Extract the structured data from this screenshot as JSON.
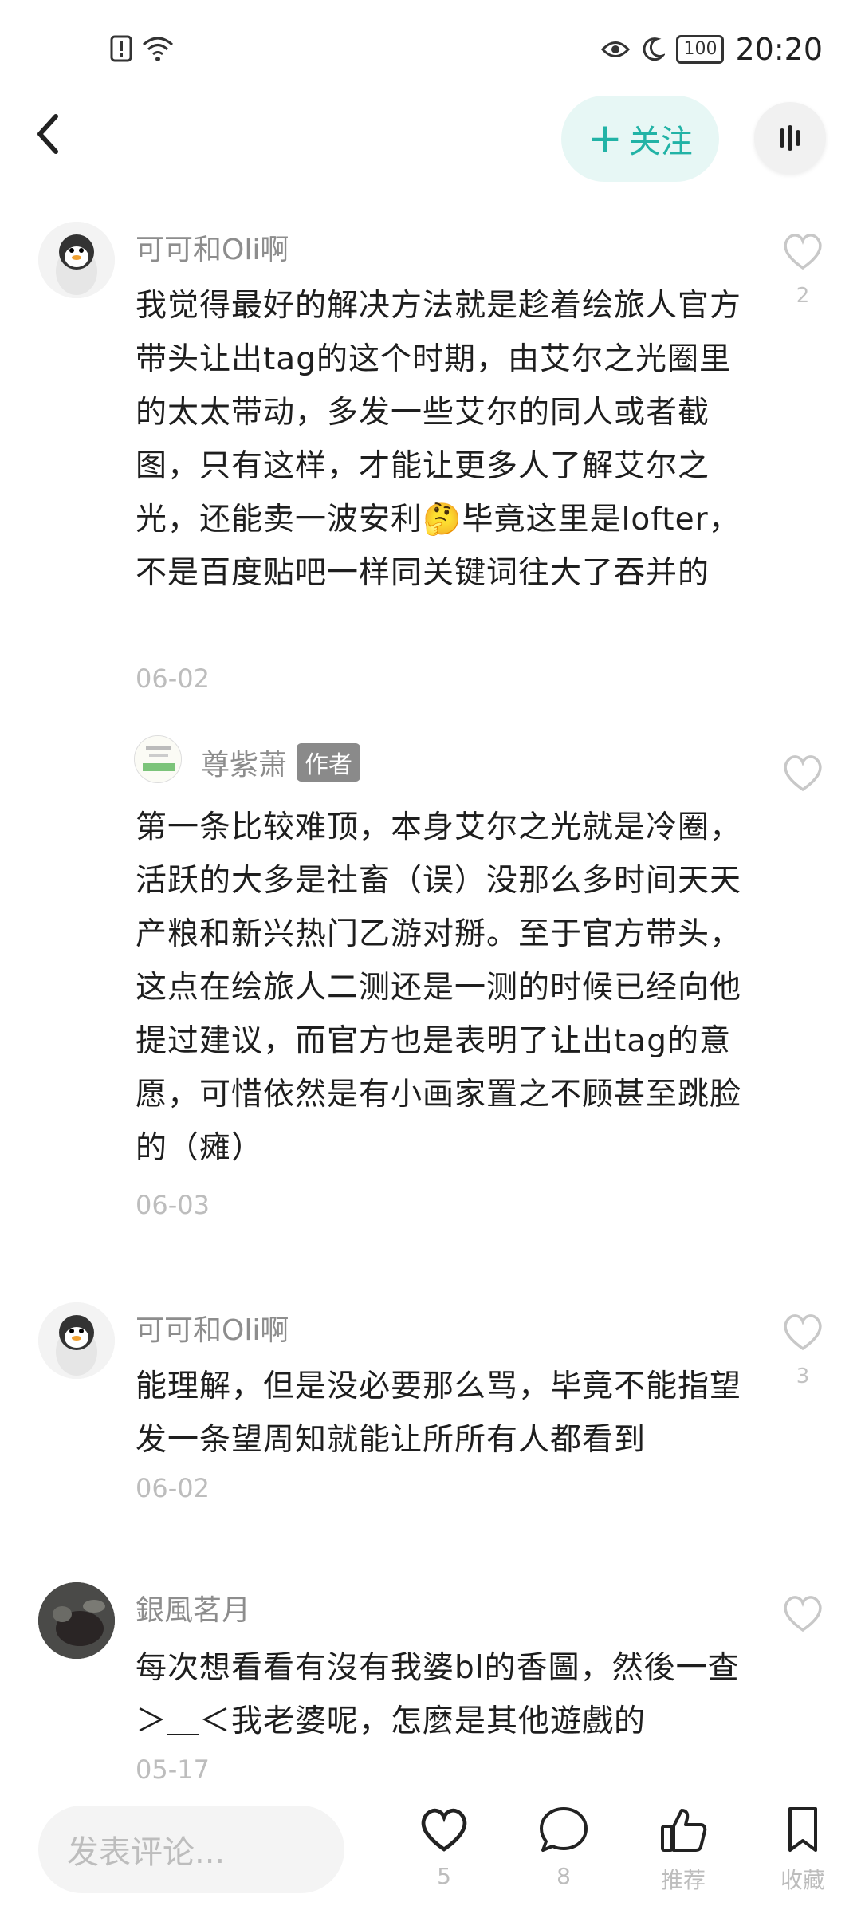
{
  "status_bar": {
    "time": "20:20",
    "battery": "100"
  },
  "header": {
    "follow_label": "关注",
    "follow_icon": "+"
  },
  "comments": [
    {
      "user": "可可和Oli啊",
      "text": "我觉得最好的解决方法就是趁着绘旅人官方带头让出tag的这个时期，由艾尔之光圈里的太太带动，多发一些艾尔的同人或者截图，只有这样，才能让更多人了解艾尔之光，还能卖一波安利🤔毕竟这里是lofter，不是百度贴吧一样同关键词往大了吞并的",
      "date": "06-02",
      "likes": "2"
    },
    {
      "user": "尊紫萧",
      "tag": "作者",
      "text": "第一条比较难顶，本身艾尔之光就是冷圈，活跃的大多是社畜（误）没那么多时间天天产粮和新兴热门乙游对掰。至于官方带头，这点在绘旅人二测还是一测的时候已经向他提过建议，而官方也是表明了让出tag的意愿，可惜依然是有小画家置之不顾甚至跳脸的（瘫）",
      "date": "06-03",
      "likes": ""
    },
    {
      "user": "可可和Oli啊",
      "text": "能理解，但是没必要那么骂，毕竟不能指望发一条望周知就能让所所有人都看到",
      "date": "06-02",
      "likes": "3"
    },
    {
      "user": "銀風茗月",
      "text": "每次想看看有沒有我婆bl的香圖，然後一查＞＿＜我老婆呢，怎麼是其他遊戲的",
      "date": "05-17",
      "likes": ""
    }
  ],
  "bottom_bar": {
    "input_placeholder": "发表评论...",
    "like_count": "5",
    "comment_count": "8",
    "recommend_label": "推荐",
    "collect_label": "收藏"
  }
}
